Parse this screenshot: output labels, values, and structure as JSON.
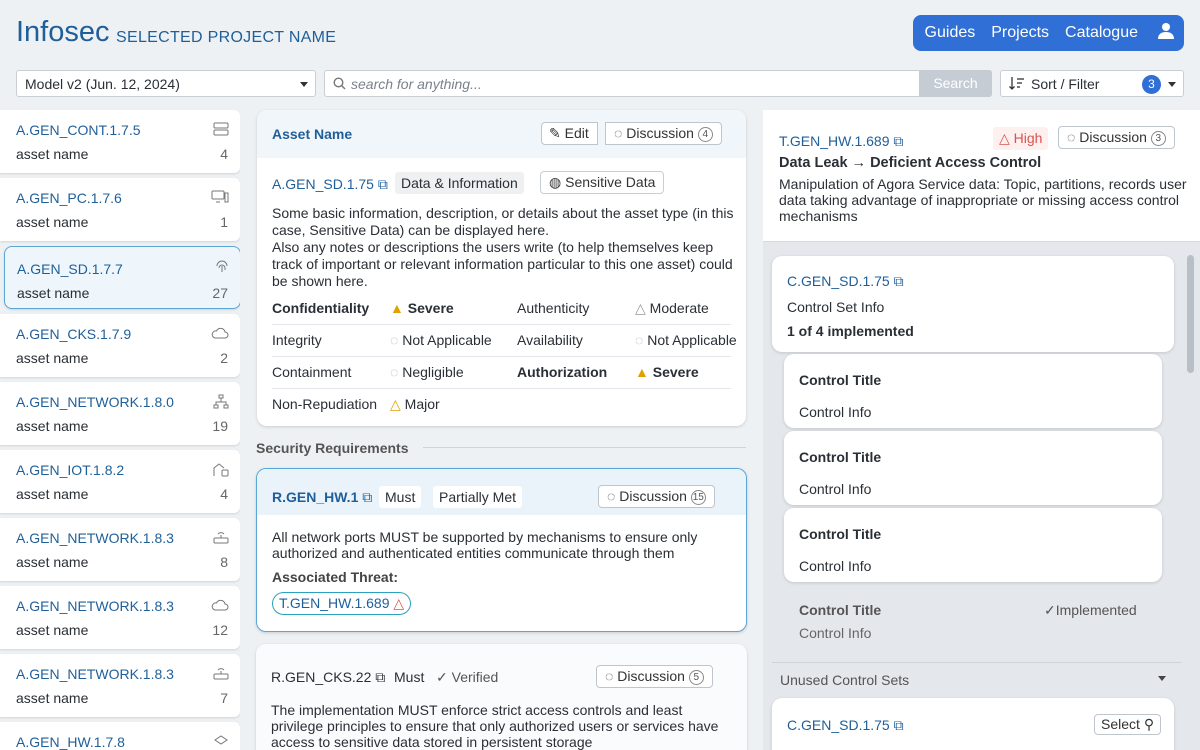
{
  "header": {
    "brand": "Infosec",
    "project": "SELECTED PROJECT NAME",
    "nav": [
      "Guides",
      "Projects",
      "Catalogue"
    ]
  },
  "toolbar": {
    "model": "Model v2 (Jun. 12, 2024)",
    "search_placeholder": "search for anything...",
    "search_button": "Search",
    "sort_label": "Sort / Filter",
    "filter_count": "3"
  },
  "assets": [
    {
      "id": "A.GEN_CONT.1.7.5",
      "name": "asset name",
      "count": "4",
      "icon": "server-icon"
    },
    {
      "id": "A.GEN_PC.1.7.6",
      "name": "asset name",
      "count": "1",
      "icon": "computer-icon"
    },
    {
      "id": "A.GEN_SD.1.7.7",
      "name": "asset name",
      "count": "27",
      "icon": "fingerprint-icon"
    },
    {
      "id": "A.GEN_CKS.1.7.9",
      "name": "asset name",
      "count": "2",
      "icon": "cloud-icon"
    },
    {
      "id": "A.GEN_NETWORK.1.8.0",
      "name": "asset name",
      "count": "19",
      "icon": "network-icon"
    },
    {
      "id": "A.GEN_IOT.1.8.2",
      "name": "asset name",
      "count": "4",
      "icon": "iot-icon"
    },
    {
      "id": "A.GEN_NETWORK.1.8.3",
      "name": "asset name",
      "count": "8",
      "icon": "router-icon"
    },
    {
      "id": "A.GEN_NETWORK.1.8.3",
      "name": "asset name",
      "count": "12",
      "icon": "cloud-icon"
    },
    {
      "id": "A.GEN_NETWORK.1.8.3",
      "name": "asset name",
      "count": "7",
      "icon": "router-icon"
    },
    {
      "id": "A.GEN_HW.1.7.8",
      "name": "",
      "count": "",
      "icon": "hardware-icon"
    }
  ],
  "asset_detail": {
    "title": "Asset Name",
    "edit": "Edit",
    "discussion": "Discussion",
    "discussion_count": "4",
    "id": "A.GEN_SD.1.75",
    "tag1": "Data & Information",
    "tag2": "Sensitive Data",
    "description": "Some basic information, description, or details about the asset type (in this case, Sensitive Data) can be displayed here.\nAlso any notes or descriptions the users write (to help themselves keep track of important or relevant information particular to this one asset) could be shown here.",
    "ratings": [
      {
        "label": "Confidentiality",
        "value": "Severe",
        "level": "severe",
        "bold": true
      },
      {
        "label": "Authenticity",
        "value": "Moderate",
        "level": "moderate",
        "bold": false
      },
      {
        "label": "Integrity",
        "value": "Not Applicable",
        "level": "na",
        "bold": false
      },
      {
        "label": "Availability",
        "value": "Not Applicable",
        "level": "na",
        "bold": false
      },
      {
        "label": "Containment",
        "value": "Negligible",
        "level": "na",
        "bold": false
      },
      {
        "label": "Authorization",
        "value": "Severe",
        "level": "severe",
        "bold": true
      },
      {
        "label": "Non-Repudiation",
        "value": "Major",
        "level": "major",
        "bold": false
      }
    ]
  },
  "sec_req": {
    "heading": "Security Requirements",
    "r1": {
      "id": "R.GEN_HW.1",
      "must": "Must",
      "status": "Partially Met",
      "discussion": "Discussion",
      "count": "15",
      "text": "All network ports MUST be supported by mechanisms to ensure only authorized and authenticated entities communicate through them",
      "assoc_label": "Associated Threat:",
      "threat": "T.GEN_HW.1.689"
    },
    "r2": {
      "id": "R.GEN_CKS.22",
      "must": "Must",
      "status": "Verified",
      "discussion": "Discussion",
      "count": "5",
      "text": "The implementation MUST enforce strict access controls and least privilege principles to ensure that only authorized users or services have access to sensitive data stored in persistent storage"
    }
  },
  "threat": {
    "id": "T.GEN_HW.1.689",
    "severity": "High",
    "discussion": "Discussion",
    "count": "3",
    "title": "Data Leak → Deficient Access Control",
    "desc": "Manipulation of Agora Service data: Topic, partitions, records user data taking advantage of inappropriate or missing access control mechanisms"
  },
  "control_set": {
    "id": "C.GEN_SD.1.75",
    "info": "Control Set Info",
    "implemented": "1 of 4 implemented",
    "controls": [
      {
        "title": "Control Title",
        "info": "Control Info"
      },
      {
        "title": "Control Title",
        "info": "Control Info"
      },
      {
        "title": "Control Title",
        "info": "Control Info"
      }
    ],
    "last": {
      "title": "Control Title",
      "info": "Control Info",
      "status": "Implemented"
    }
  },
  "unused": {
    "heading": "Unused Control Sets",
    "id": "C.GEN_SD.1.75",
    "select": "Select"
  },
  "colors": {
    "accent": "#2f6fd6",
    "link": "#1f5f99",
    "severe": "#e0a100",
    "high": "#d9534f"
  }
}
